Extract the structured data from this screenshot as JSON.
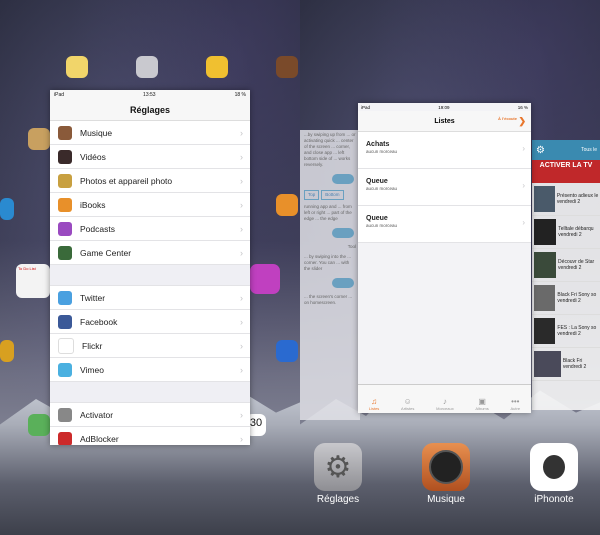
{
  "settings": {
    "status": {
      "carrier": "iPad",
      "time": "13:53",
      "battery": "18 %"
    },
    "title": "Réglages",
    "group1": [
      {
        "label": "Musique",
        "icon": "music-icon",
        "color": "#8a5a3a"
      },
      {
        "label": "Vidéos",
        "icon": "video-icon",
        "color": "#3a2a2a"
      },
      {
        "label": "Photos et appareil photo",
        "icon": "photos-icon",
        "color": "#c8a040"
      },
      {
        "label": "iBooks",
        "icon": "ibooks-icon",
        "color": "#e8902a"
      },
      {
        "label": "Podcasts",
        "icon": "podcasts-icon",
        "color": "#9a4ac0"
      },
      {
        "label": "Game Center",
        "icon": "game-center-icon",
        "color": "#3a6a3a"
      }
    ],
    "group2": [
      {
        "label": "Twitter",
        "icon": "twitter-icon",
        "color": "#4aa0e0"
      },
      {
        "label": "Facebook",
        "icon": "facebook-icon",
        "color": "#3b5998"
      },
      {
        "label": "Flickr",
        "icon": "flickr-icon",
        "color": "#ffffff"
      },
      {
        "label": "Vimeo",
        "icon": "vimeo-icon",
        "color": "#4ab0e0"
      }
    ],
    "group3": [
      {
        "label": "Activator",
        "icon": "activator-icon",
        "color": "#888888"
      },
      {
        "label": "AdBlocker",
        "icon": "adblocker-icon",
        "color": "#cc2a2a"
      }
    ]
  },
  "music": {
    "status": {
      "carrier": "iPad",
      "time": "19:09",
      "battery": "16 %"
    },
    "title": "Listes",
    "back_label": "À l'écoute",
    "rows": [
      {
        "title": "Achats",
        "subtitle": "aucun morceau"
      },
      {
        "title": "Queue",
        "subtitle": "aucun morceau"
      },
      {
        "title": "Queue",
        "subtitle": "aucun morceau"
      }
    ],
    "tabs": [
      {
        "label": "Listes",
        "icon": "playlist-icon",
        "active": true
      },
      {
        "label": "Artistes",
        "icon": "artists-icon",
        "active": false
      },
      {
        "label": "Morceaux",
        "icon": "songs-icon",
        "active": false
      },
      {
        "label": "Albums",
        "icon": "albums-icon",
        "active": false
      },
      {
        "label": "Autre",
        "icon": "more-icon",
        "active": false
      }
    ]
  },
  "ghost_left": {
    "text1": "...by swiping up from ... or activating quick ... center of the screen ... corner, and close app ... left bottom side of ... works reversely.",
    "top_btn": "Top",
    "bottom_btn": "Bottom",
    "text2": "running app and ... from left or right ... part of the edge ... the edge",
    "tool": "Tool",
    "text3": "... by swiping into the ... corner. You can ... with the slider",
    "text4": "... the screen's corner ... on homescreen."
  },
  "ghost_right": {
    "top_label": "Tous le",
    "banner": "ACTIVER LA TV",
    "items": [
      {
        "text": "Présento adieux le vendredi 2"
      },
      {
        "text": "Telltale débarqu vendredi 2"
      },
      {
        "text": "Découvr de Star vendredi 2"
      },
      {
        "text": "Black Fri Sony so vendredi 2"
      },
      {
        "text": "FES : La Sony so vendredi 2"
      },
      {
        "text": "Black Fri vendredi 2"
      }
    ]
  },
  "dock": [
    {
      "label": "Réglages",
      "icon": "settings-gear-icon"
    },
    {
      "label": "Musique",
      "icon": "music-turntable-icon"
    },
    {
      "label": "iPhonote",
      "icon": "iphonote-icon"
    }
  ],
  "left_side": {
    "todo_label": "To Do List",
    "calendar_day": "30"
  }
}
